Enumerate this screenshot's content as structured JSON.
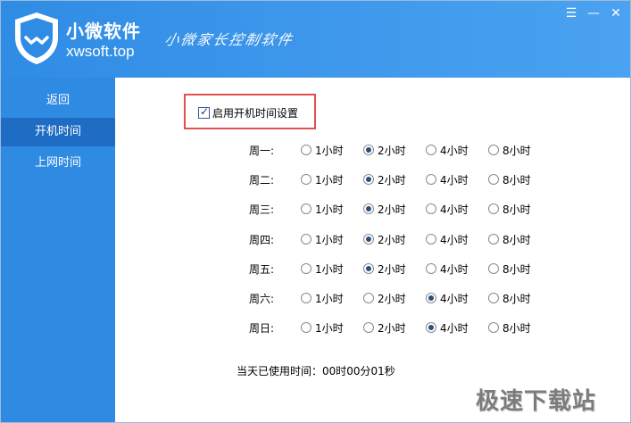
{
  "header": {
    "brand_name": "小微软件",
    "brand_domain": "xwsoft.top",
    "slogan": "小微家长控制软件",
    "minimize_icon": "menu-icon",
    "minimize_label": "☰",
    "min_label": "—",
    "close_label": "✕"
  },
  "sidebar": {
    "items": [
      {
        "label": "返回"
      },
      {
        "label": "开机时间",
        "active": true
      },
      {
        "label": "上网时间"
      }
    ]
  },
  "settings": {
    "enable_label": "启用开机时间设置",
    "enable_checked": true,
    "options": [
      "1小时",
      "2小时",
      "4小时",
      "8小时"
    ],
    "days": [
      {
        "label": "周一:",
        "selected": "2小时"
      },
      {
        "label": "周二:",
        "selected": "2小时"
      },
      {
        "label": "周三:",
        "selected": "2小时"
      },
      {
        "label": "周四:",
        "selected": "2小时"
      },
      {
        "label": "周五:",
        "selected": "2小时"
      },
      {
        "label": "周六:",
        "selected": "4小时"
      },
      {
        "label": "周日:",
        "selected": "4小时"
      }
    ],
    "usage_text": "当天已使用时间：00时00分01秒"
  },
  "watermark": "极速下载站"
}
